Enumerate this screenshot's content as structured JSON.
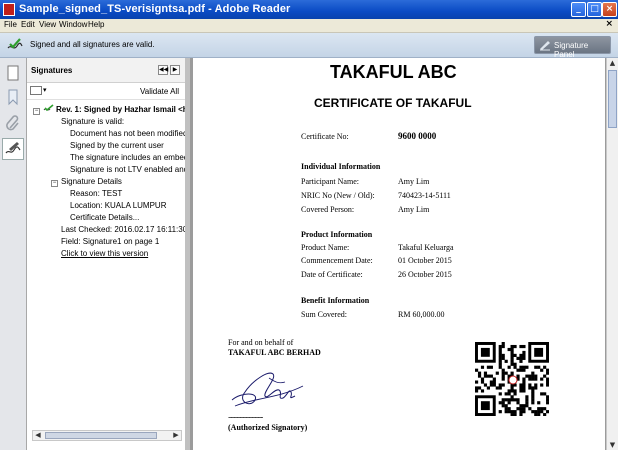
{
  "window": {
    "title": "Sample_signed_TS-verisigntsa.pdf - Adobe Reader"
  },
  "menu": {
    "items": [
      "File",
      "Edit",
      "View",
      "Window",
      "Help"
    ],
    "close_doc": "×"
  },
  "signature_bar": {
    "status": "Signed and all signatures are valid.",
    "panel_button": "Signature Panel"
  },
  "panel": {
    "title": "Signatures",
    "validate_all": "Validate All",
    "tree": [
      {
        "text": "Rev. 1: Signed by Hazhar Ismail <h",
        "level": 0,
        "bold": true,
        "expander": "⊟"
      },
      {
        "text": "Signature is valid:",
        "level": 1
      },
      {
        "text": "Document has not been modified",
        "level": 2
      },
      {
        "text": "Signed by the current user",
        "level": 2
      },
      {
        "text": "The signature includes an embedd",
        "level": 2
      },
      {
        "text": "Signature is not LTV enabled and",
        "level": 2
      },
      {
        "text": "Signature Details",
        "level": 1,
        "expander": "⊟"
      },
      {
        "text": "Reason: TEST",
        "level": 2
      },
      {
        "text": "Location: KUALA LUMPUR",
        "level": 2
      },
      {
        "text": "Certificate Details...",
        "level": 2
      },
      {
        "text": "Last Checked: 2016.02.17 16:11:30",
        "level": 1
      },
      {
        "text": "Field: Signature1 on page 1",
        "level": 1
      },
      {
        "text": "Click to view this version",
        "level": 1,
        "link": true
      }
    ]
  },
  "document": {
    "company": "TAKAFUL ABC",
    "certificate_title": "CERTIFICATE OF TAKAFUL",
    "certificate_no_label": "Certificate No:",
    "certificate_no": "9600 0000",
    "individual_heading": "Individual Information",
    "participant_label": "Participant Name:",
    "participant": "Amy Lim",
    "nric_label": "NRIC No (New / Old):",
    "nric": "740423-14-5111",
    "covered_label": "Covered Person:",
    "covered": "Amy Lim",
    "product_heading": "Product Information",
    "product_name_label": "Product Name:",
    "product_name": "Takaful Keluarga",
    "commencement_label": "Commencement Date:",
    "commencement": "01 October 2015",
    "date_cert_label": "Date of Certificate:",
    "date_cert": "26 October 2015",
    "benefit_heading": "Benefit Information",
    "sum_label": "Sum Covered:",
    "sum": "RM 60,000.00",
    "behalf": "For and on behalf of",
    "berhad": "TAKAFUL ABC BERHAD",
    "dots": "..............................................",
    "authorized": "(Authorized Signatory)"
  }
}
